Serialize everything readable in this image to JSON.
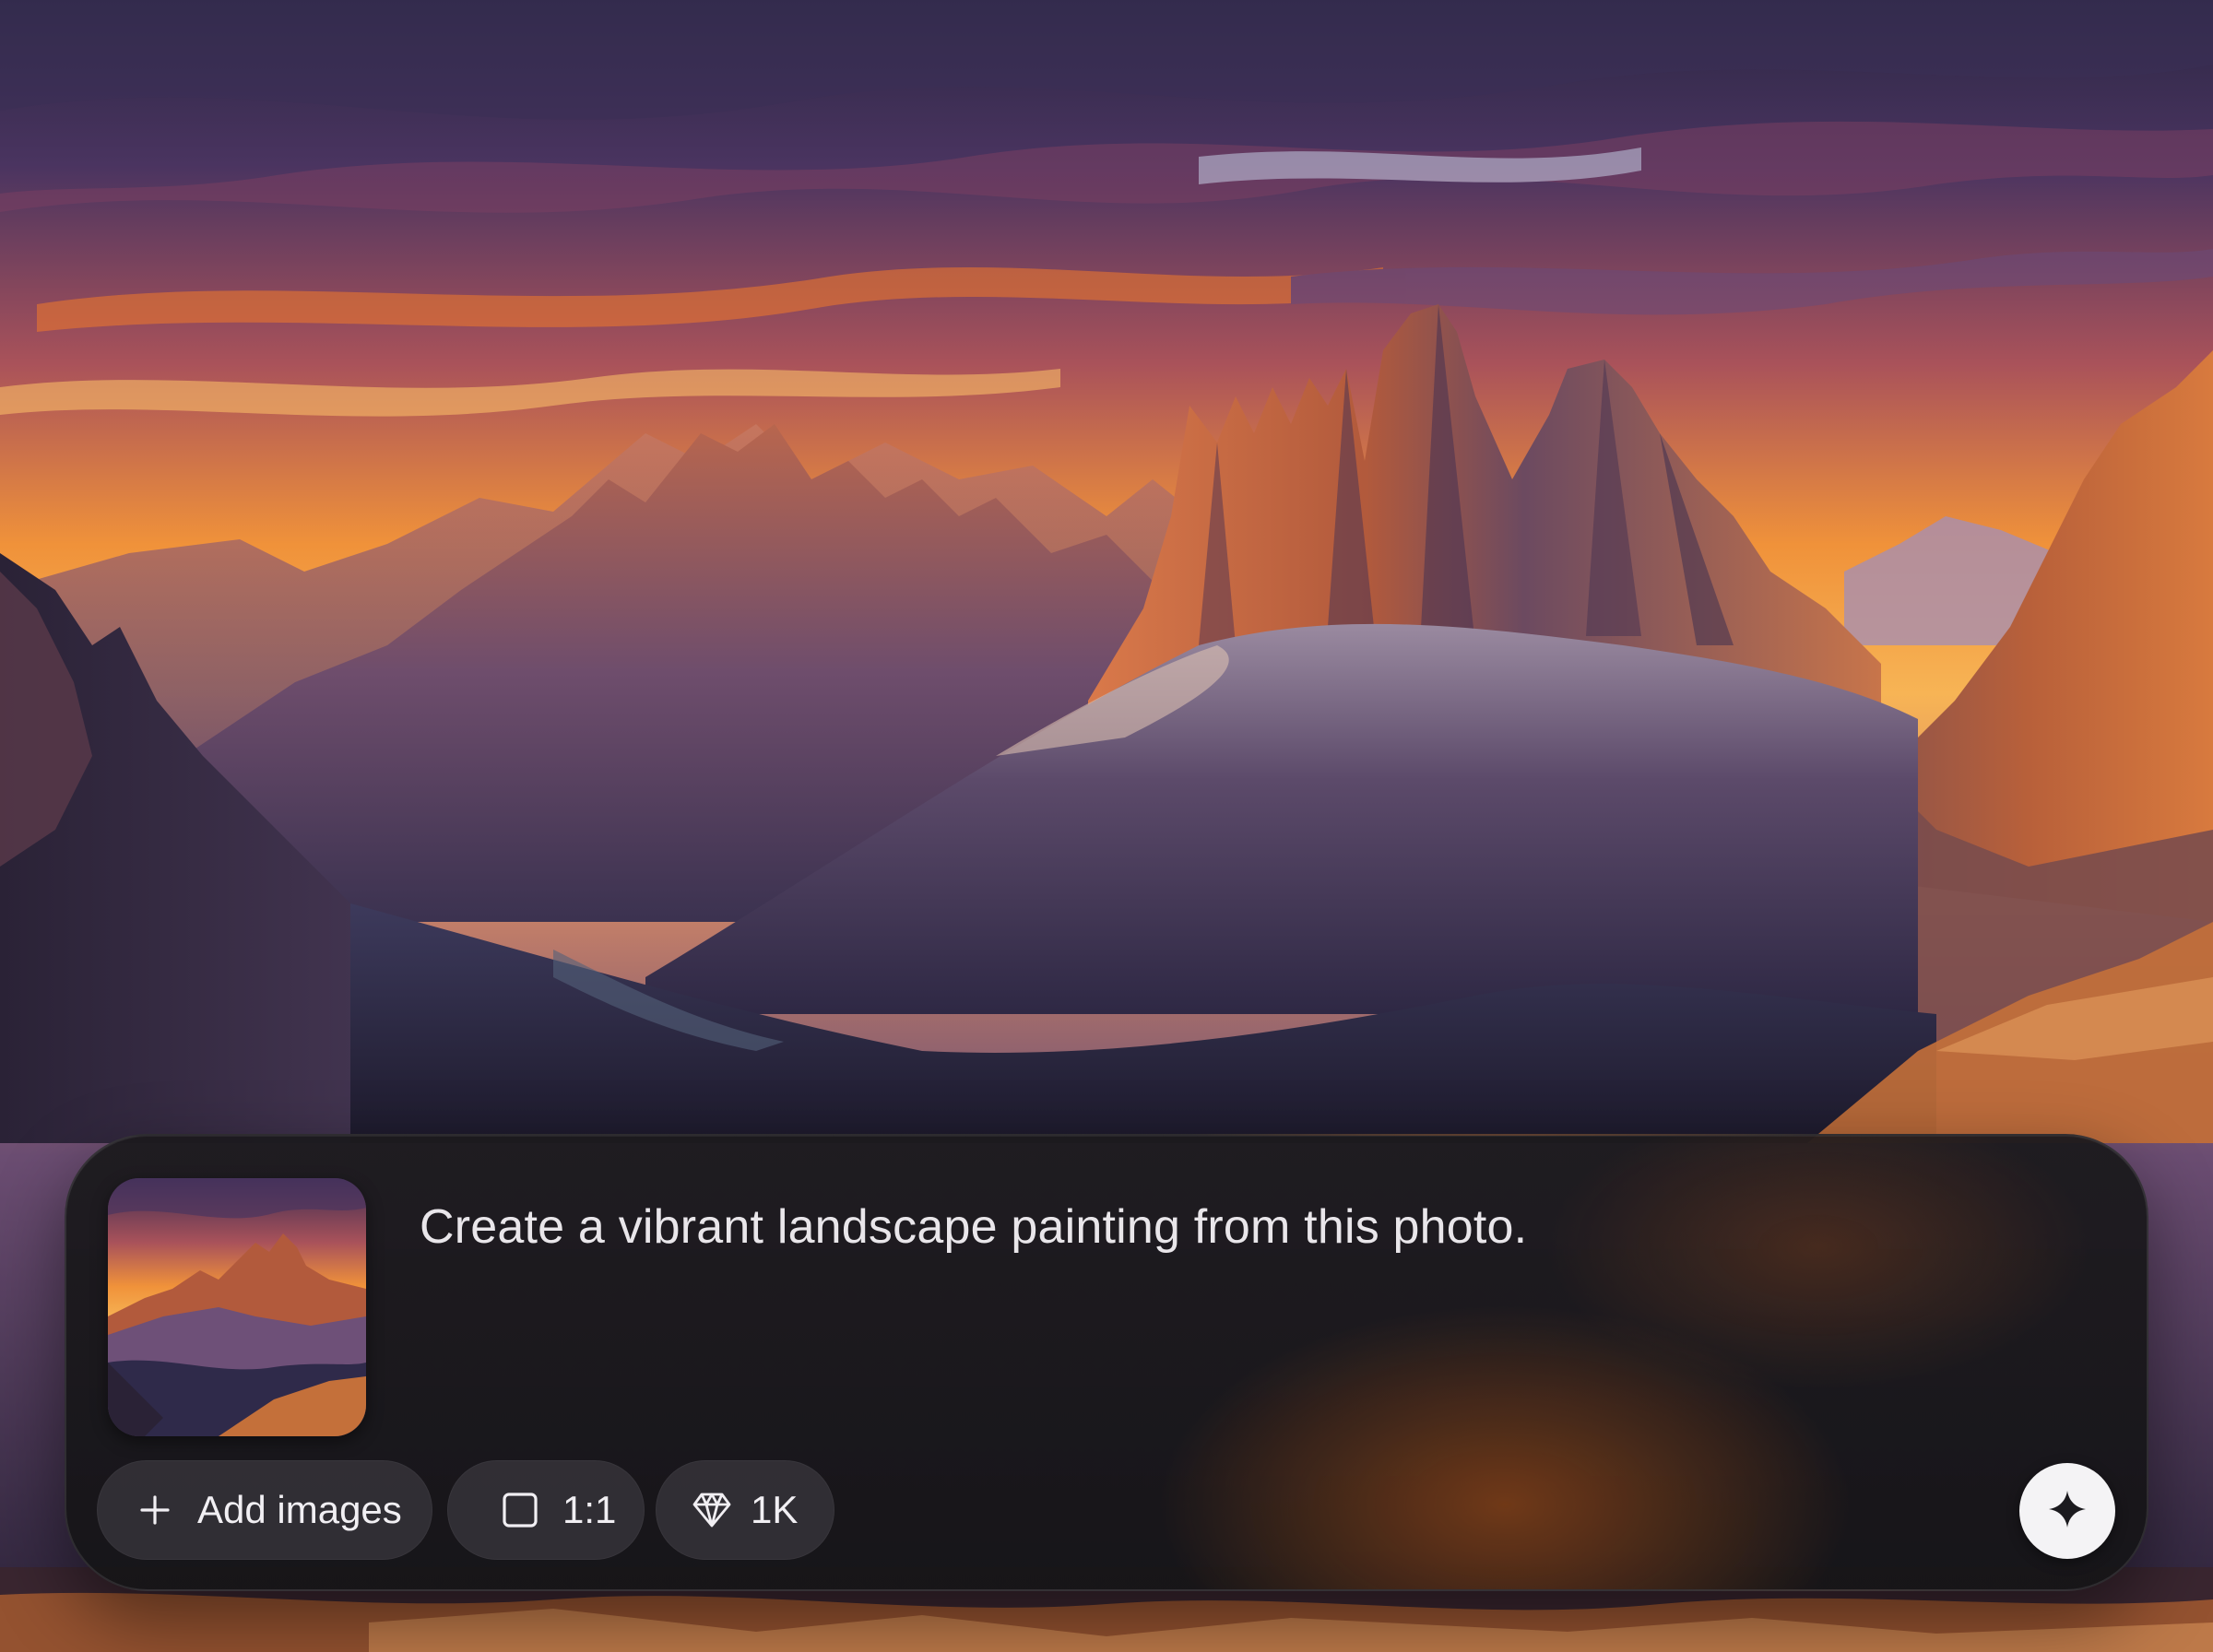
{
  "composer": {
    "prompt_text": "Create a vibrant landscape painting from this photo.",
    "attachment_icon": "landscape-thumbnail",
    "add_images": {
      "label": "Add images",
      "icon": "plus-icon"
    },
    "aspect_ratio": {
      "label": "1:1",
      "icon": "square-icon"
    },
    "resolution": {
      "label": "1K",
      "icon": "diamond-icon"
    },
    "generate": {
      "icon": "sparkle-icon"
    }
  },
  "colors": {
    "sky_top": "#3a2c52",
    "sunset_orange": "#f0923a",
    "peak_light": "#d9794a",
    "valley_shadow": "#2f2a4a",
    "panel": "#1c1a1f",
    "chip": "#3a383e",
    "send_button": "#f4f3f5"
  }
}
